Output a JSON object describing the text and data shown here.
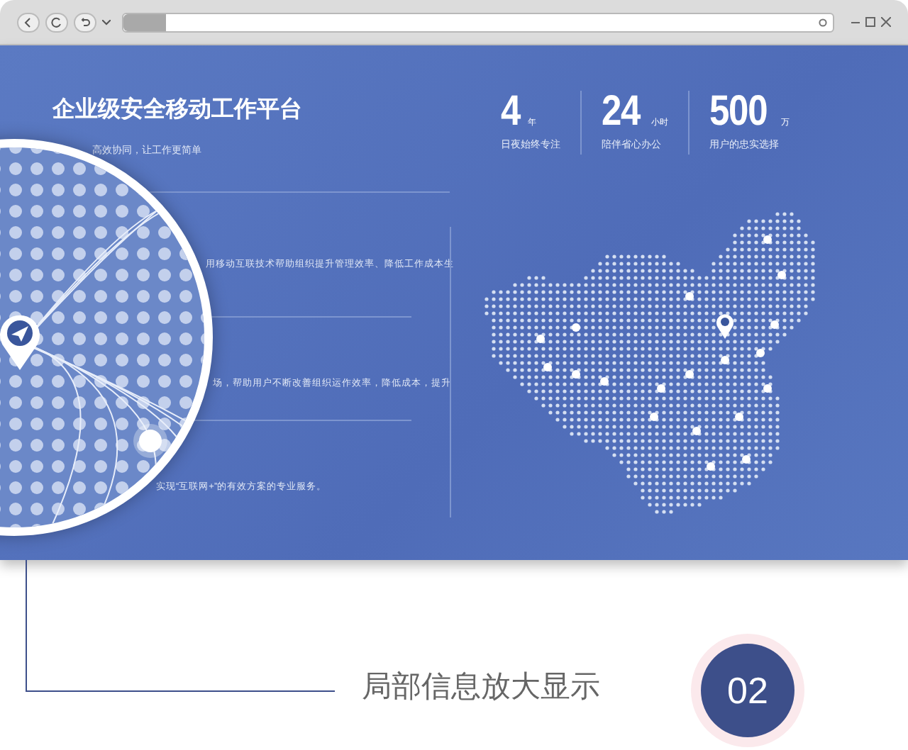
{
  "hero": {
    "title": "企业级安全移动工作平台",
    "subtitle": "高效协同，让工作更简单",
    "stats": [
      {
        "number": "4",
        "unit": "年",
        "caption": "日夜始终专注"
      },
      {
        "number": "24",
        "unit": "小时",
        "caption": "陪伴省心办公"
      },
      {
        "number": "500",
        "unit": "万",
        "caption": "用户的忠实选择"
      }
    ],
    "paragraphs": [
      "用移动互联技术帮助组织提升管理效率、降低工作成本生",
      "场，帮助用户不断改善组织运作效率，降低成本，提升",
      "实现“互联网+”的有效方案的专业服务。"
    ]
  },
  "caption": {
    "text": "局部信息放大显示",
    "badge": "02"
  }
}
